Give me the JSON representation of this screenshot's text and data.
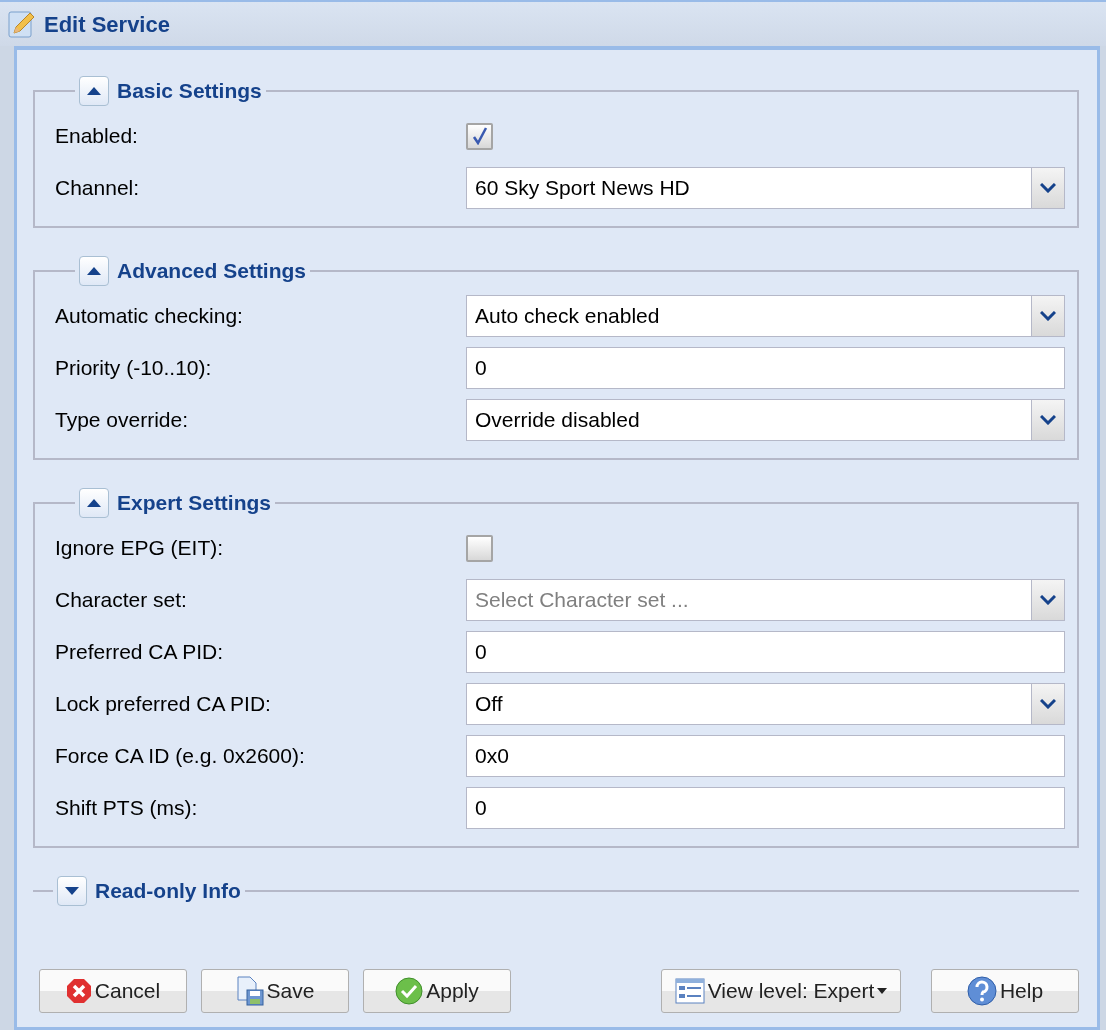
{
  "window": {
    "title": "Edit Service"
  },
  "sections": [
    {
      "title": "Basic Settings",
      "expanded": true,
      "fields": [
        {
          "kind": "checkbox",
          "label": "Enabled:",
          "checked": true
        },
        {
          "kind": "select",
          "label": "Channel:",
          "value": "60 Sky Sport News HD"
        }
      ]
    },
    {
      "title": "Advanced Settings",
      "expanded": true,
      "fields": [
        {
          "kind": "select",
          "label": "Automatic checking:",
          "value": "Auto check enabled"
        },
        {
          "kind": "text",
          "label": "Priority (-10..10):",
          "value": "0"
        },
        {
          "kind": "select",
          "label": "Type override:",
          "value": "Override disabled"
        }
      ]
    },
    {
      "title": "Expert Settings",
      "expanded": true,
      "fields": [
        {
          "kind": "checkbox",
          "label": "Ignore EPG (EIT):",
          "checked": false
        },
        {
          "kind": "select",
          "label": "Character set:",
          "placeholder": "Select Character set ..."
        },
        {
          "kind": "text",
          "label": "Preferred CA PID:",
          "value": "0"
        },
        {
          "kind": "select",
          "label": "Lock preferred CA PID:",
          "value": "Off"
        },
        {
          "kind": "text",
          "label": "Force CA ID (e.g. 0x2600):",
          "value": "0x0"
        },
        {
          "kind": "text",
          "label": "Shift PTS (ms):",
          "value": "0"
        }
      ]
    },
    {
      "title": "Read-only Info",
      "expanded": false
    }
  ],
  "buttons": [
    {
      "kind": "cancel",
      "label": "Cancel"
    },
    {
      "kind": "save",
      "label": "Save"
    },
    {
      "kind": "apply",
      "label": "Apply"
    },
    {
      "kind": "view",
      "label": "View level: Expert",
      "menu": true
    },
    {
      "kind": "help",
      "label": "Help"
    }
  ]
}
